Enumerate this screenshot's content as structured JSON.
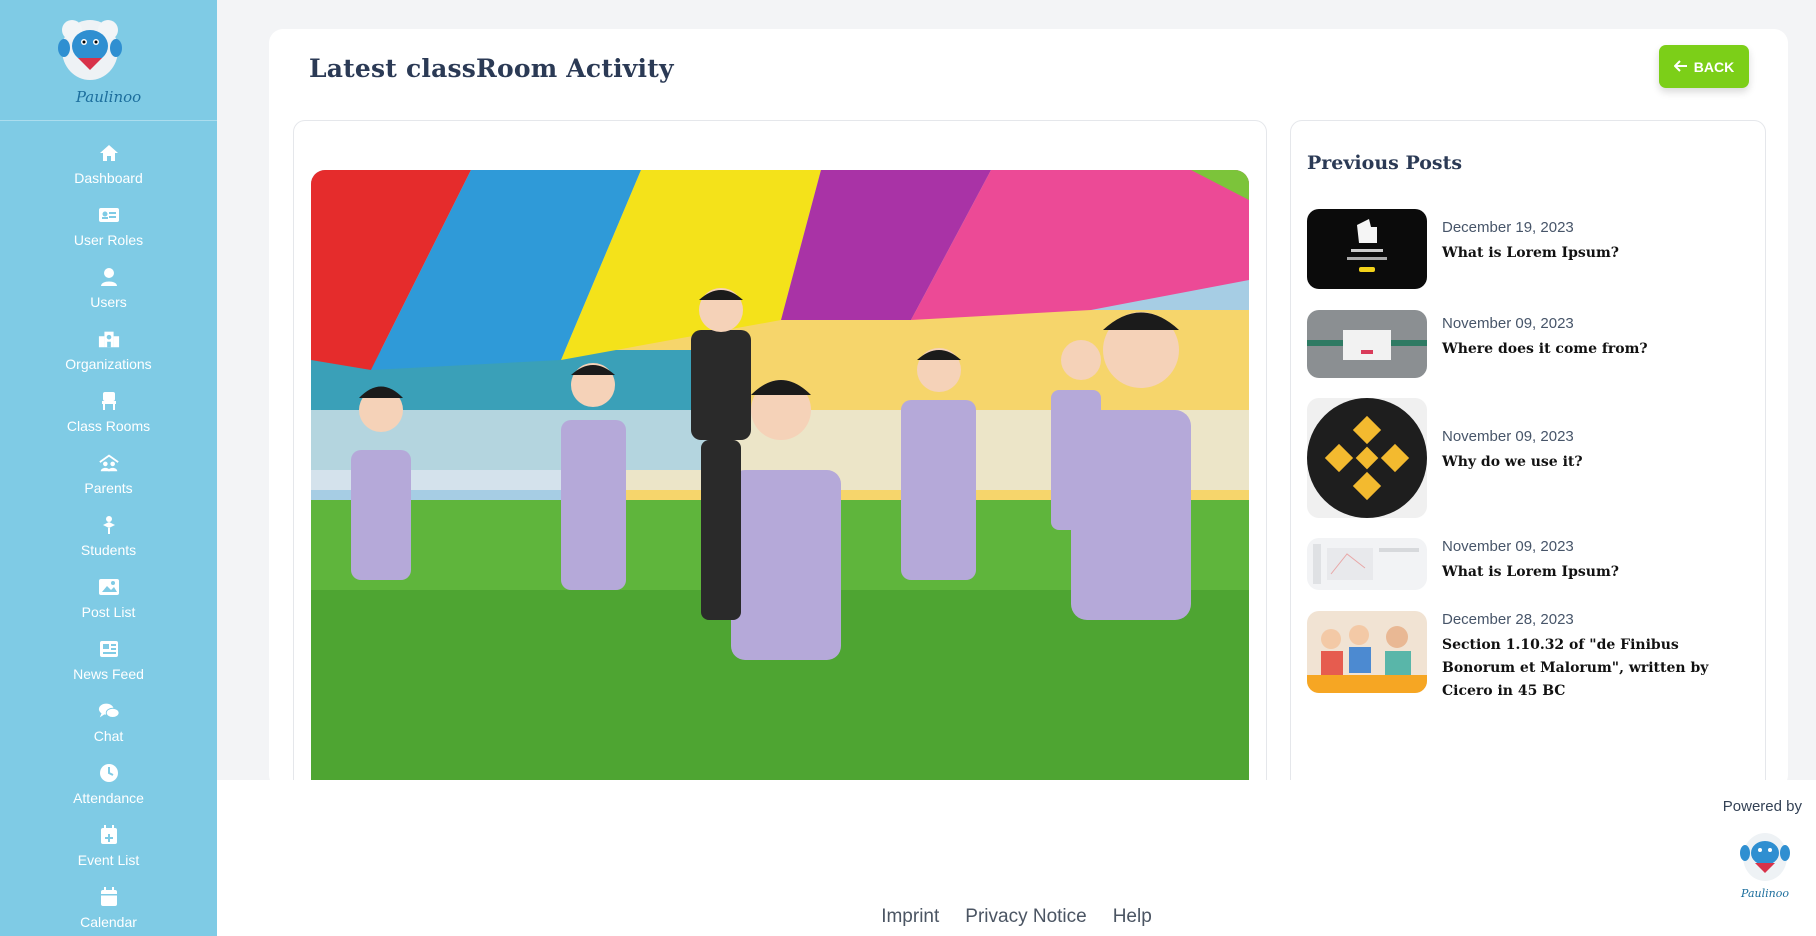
{
  "brand": {
    "name": "Paulinoo"
  },
  "sidebar": {
    "items": [
      {
        "label": "Dashboard",
        "icon": "home-icon"
      },
      {
        "label": "User Roles",
        "icon": "id-card-icon"
      },
      {
        "label": "Users",
        "icon": "user-icon"
      },
      {
        "label": "Organizations",
        "icon": "school-icon"
      },
      {
        "label": "Class Rooms",
        "icon": "chair-icon"
      },
      {
        "label": "Parents",
        "icon": "parents-icon"
      },
      {
        "label": "Students",
        "icon": "student-icon"
      },
      {
        "label": "Post List",
        "icon": "images-icon"
      },
      {
        "label": "News Feed",
        "icon": "newspaper-icon"
      },
      {
        "label": "Chat",
        "icon": "chat-icon"
      },
      {
        "label": "Attendance",
        "icon": "clock-icon"
      },
      {
        "label": "Event List",
        "icon": "calendar-plus-icon"
      },
      {
        "label": "Calendar",
        "icon": "calendar-icon"
      }
    ]
  },
  "header": {
    "title": "Latest classRoom Activity",
    "back_label": "BACK"
  },
  "previous": {
    "title": "Previous Posts",
    "posts": [
      {
        "date": "December 19, 2023",
        "title": "What is Lorem Ipsum?"
      },
      {
        "date": "November 09, 2023",
        "title": "Where does it come from?"
      },
      {
        "date": "November 09, 2023",
        "title": "Why do we use it?"
      },
      {
        "date": "November 09, 2023",
        "title": "What is Lorem Ipsum?"
      },
      {
        "date": "December 28, 2023",
        "title": "Section 1.10.32 of \"de Finibus Bonorum et Malorum\", written by Cicero in 45 BC"
      }
    ]
  },
  "footer": {
    "powered": "Powered by",
    "links": [
      "Imprint",
      "Privacy Notice",
      "Help"
    ]
  },
  "colors": {
    "sidebar": "#7fcbe5",
    "accent": "#7ccf18",
    "title": "#2b3a55"
  }
}
